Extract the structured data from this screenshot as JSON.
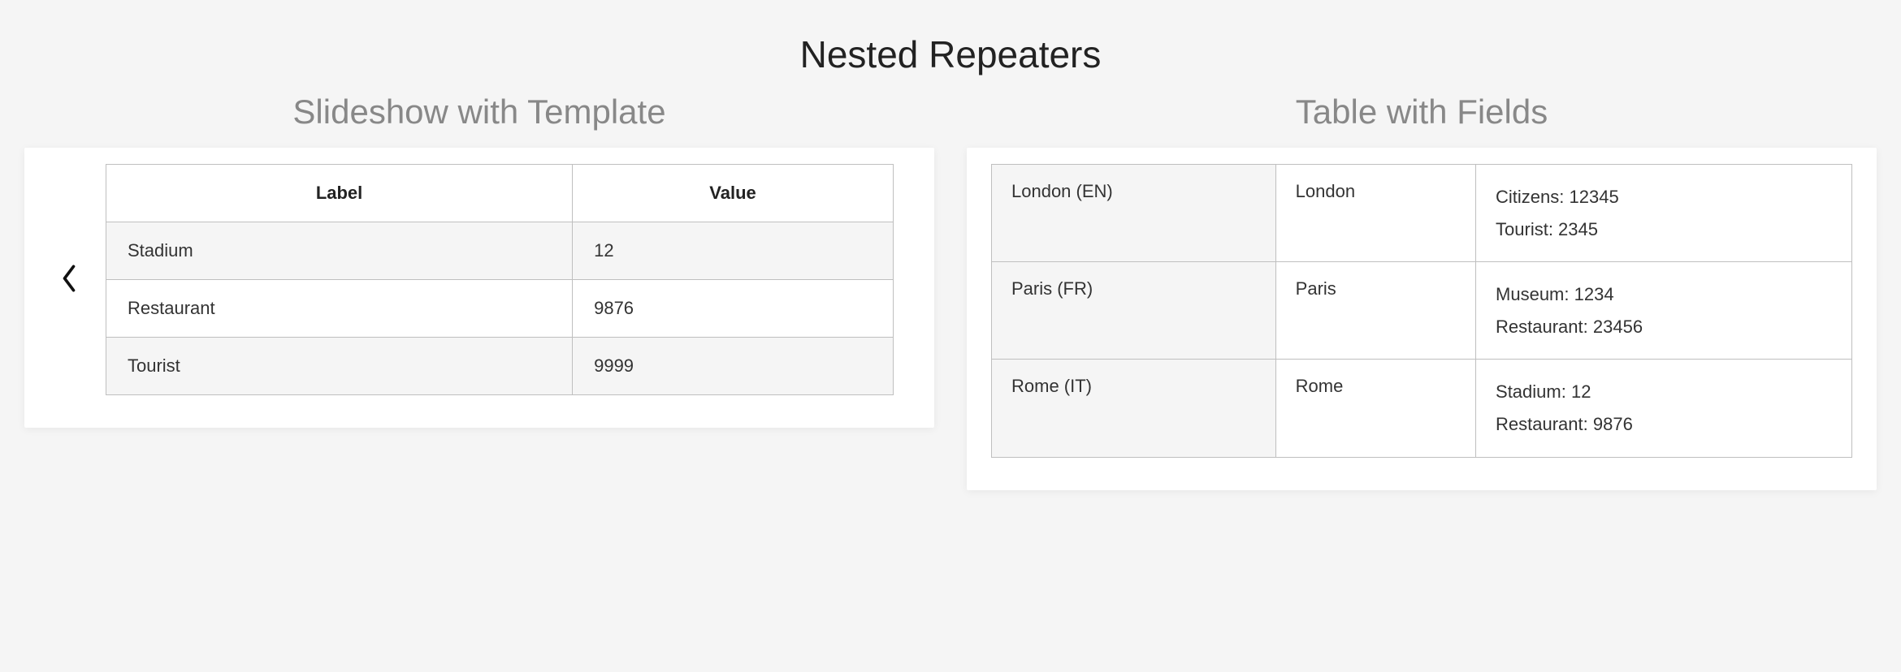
{
  "page_title": "Nested Repeaters",
  "left": {
    "title": "Slideshow with Template",
    "headers": {
      "label": "Label",
      "value": "Value"
    },
    "rows": [
      {
        "label": "Stadium",
        "value": "12"
      },
      {
        "label": "Restaurant",
        "value": "9876"
      },
      {
        "label": "Tourist",
        "value": "9999"
      }
    ]
  },
  "right": {
    "title": "Table with Fields",
    "rows": [
      {
        "title": "London (EN)",
        "key": "London",
        "items": [
          {
            "k": "Citizens",
            "v": "12345"
          },
          {
            "k": "Tourist",
            "v": "2345"
          }
        ]
      },
      {
        "title": "Paris (FR)",
        "key": "Paris",
        "items": [
          {
            "k": "Museum",
            "v": "1234"
          },
          {
            "k": "Restaurant",
            "v": "23456"
          }
        ]
      },
      {
        "title": "Rome (IT)",
        "key": "Rome",
        "items": [
          {
            "k": "Stadium",
            "v": "12"
          },
          {
            "k": "Restaurant",
            "v": "9876"
          }
        ]
      }
    ]
  }
}
